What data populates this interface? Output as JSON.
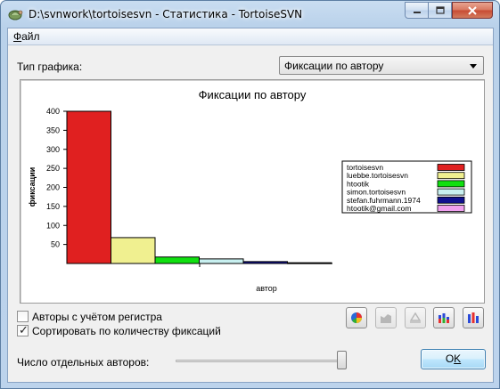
{
  "window": {
    "title": "D:\\svnwork\\tortoisesvn - Статистика - TortoiseSVN"
  },
  "menu": {
    "file_prefix": "Ф",
    "file_rest": "айл"
  },
  "graph_type": {
    "label": "Тип графика:",
    "selected": "Фиксации по автору"
  },
  "chart_data": {
    "type": "bar",
    "title": "Фиксации по автору",
    "xlabel": "автор",
    "ylabel": "фиксации",
    "ylim": [
      0,
      400
    ],
    "yticks": [
      "50",
      "100",
      "150",
      "200",
      "250",
      "300",
      "350",
      "400"
    ],
    "categories": [
      "tortoisesvn",
      "luebbe.tortoisesvn",
      "htootik",
      "simon.tortoisesvn",
      "stefan.fuhrmann.1974",
      "htootik@gmail.com"
    ],
    "values": [
      400,
      68,
      17,
      12,
      5,
      2
    ],
    "colors": [
      "#e02020",
      "#f0f090",
      "#10e010",
      "#c8f0f0",
      "#101090",
      "#f0a0f0"
    ],
    "legend": "right",
    "grid": false
  },
  "options": {
    "case_sensitive_label": "Авторы с учётом регистра",
    "case_sensitive_checked": false,
    "sort_label": "Сортировать по количеству фиксаций",
    "sort_checked": true
  },
  "authors_count": {
    "label": "Число отдельных авторов:",
    "slider_fraction": 1.0
  },
  "ok": {
    "prefix": "O",
    "underlined": "K"
  },
  "icons": [
    "pie-chart-icon",
    "area-chart-icon",
    "stacked-chart-icon",
    "stacked-bar-icon",
    "bar-chart-icon"
  ]
}
